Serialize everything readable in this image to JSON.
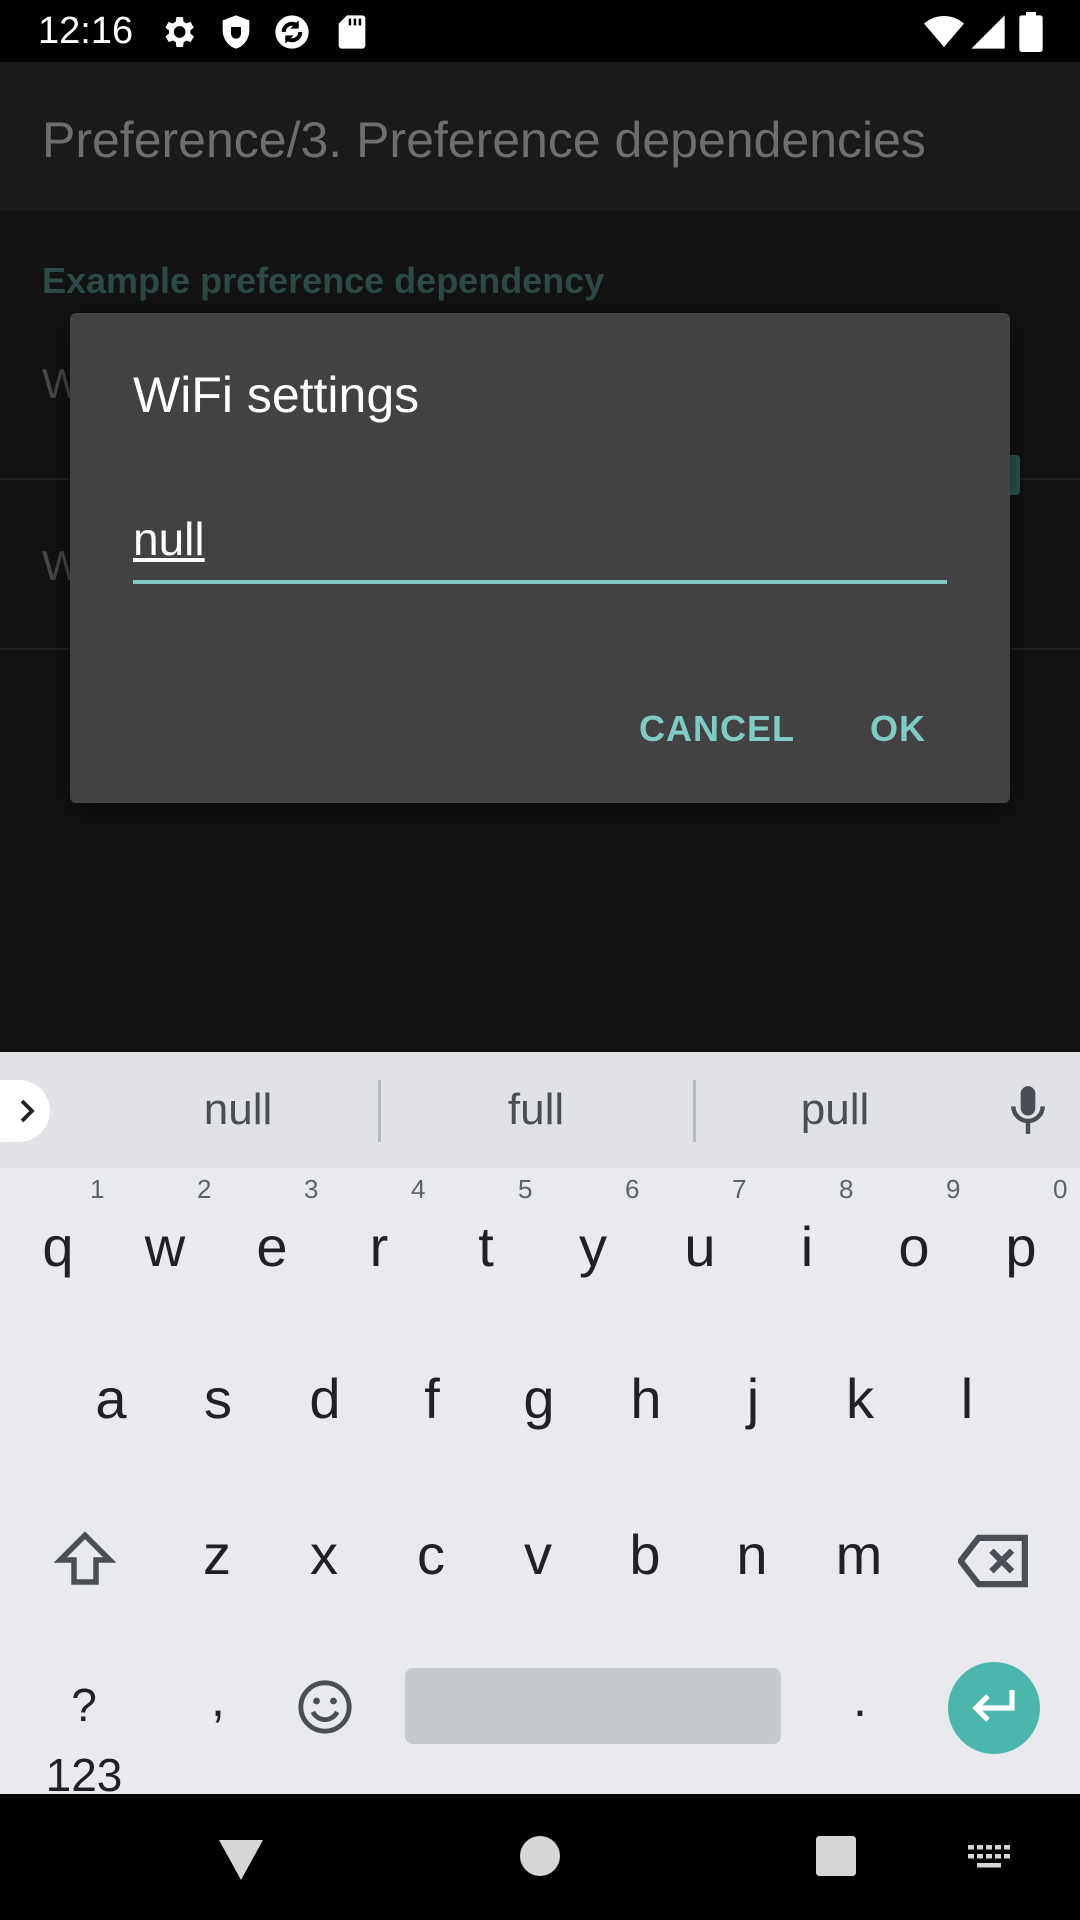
{
  "status_bar": {
    "time": "12:16",
    "icons": [
      "settings-icon",
      "shield-icon",
      "sync-icon",
      "sd-card-icon",
      "wifi-icon",
      "signal-icon",
      "battery-icon"
    ]
  },
  "app_bar": {
    "title": "Preference/3. Preference dependencies"
  },
  "preferences": {
    "category": "Example preference dependency",
    "items": [
      {
        "label": "W"
      },
      {
        "label": "W"
      }
    ]
  },
  "dialog": {
    "title": "WiFi settings",
    "input_value": "null",
    "cancel_label": "CANCEL",
    "ok_label": "OK"
  },
  "keyboard": {
    "suggestions": [
      "null",
      "full",
      "pull"
    ],
    "row1": [
      "q",
      "w",
      "e",
      "r",
      "t",
      "y",
      "u",
      "i",
      "o",
      "p"
    ],
    "row1_hints": [
      "1",
      "2",
      "3",
      "4",
      "5",
      "6",
      "7",
      "8",
      "9",
      "0"
    ],
    "row2": [
      "a",
      "s",
      "d",
      "f",
      "g",
      "h",
      "j",
      "k",
      "l"
    ],
    "row3": [
      "z",
      "x",
      "c",
      "v",
      "b",
      "n",
      "m"
    ],
    "symbols_label": "?123",
    "comma": ",",
    "period": "."
  },
  "colors": {
    "accent": "#80cbc4",
    "dialog_bg": "#424242",
    "enter_key": "#4db6ac",
    "keyboard_bg": "#e8eaed"
  }
}
